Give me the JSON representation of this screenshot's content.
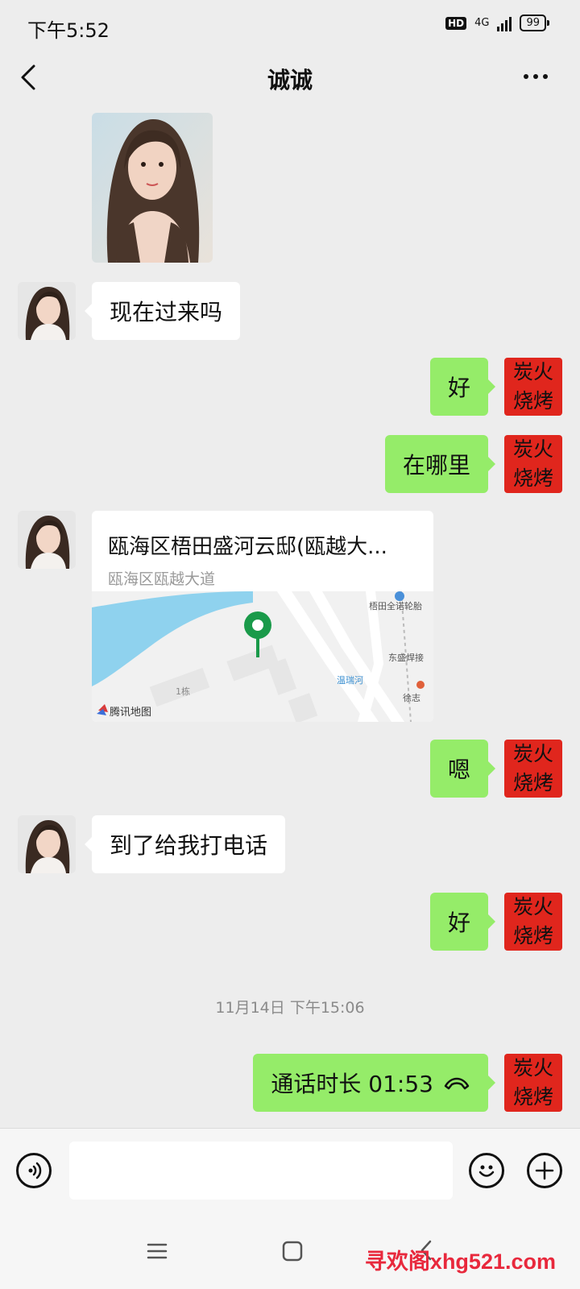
{
  "status_bar": {
    "time": "下午5:52",
    "hd_badge": "HD",
    "network": "4G",
    "battery": "99"
  },
  "header": {
    "title": "诚诚"
  },
  "messages": [
    {
      "type": "image",
      "from": "contact"
    },
    {
      "type": "text",
      "from": "contact",
      "text": "现在过来吗"
    },
    {
      "type": "text",
      "from": "me",
      "text": "好"
    },
    {
      "type": "text",
      "from": "me",
      "text": "在哪里"
    },
    {
      "type": "location",
      "from": "contact",
      "title": "瓯海区梧田盛河云邸(瓯越大...",
      "subtitle": "瓯海区瓯越大道",
      "map_labels": {
        "poi1": "梧田全诺轮胎",
        "poi2": "东盛焊接",
        "river": "温瑞河",
        "building": "1栋",
        "poi3": "徐志",
        "provider": "腾讯地图"
      }
    },
    {
      "type": "text",
      "from": "me",
      "text": "嗯"
    },
    {
      "type": "text",
      "from": "contact",
      "text": "到了给我打电话"
    },
    {
      "type": "text",
      "from": "me",
      "text": "好"
    },
    {
      "type": "timestamp",
      "text": "11月14日 下午15:06"
    },
    {
      "type": "call",
      "from": "me",
      "text": "通话时长 01:53"
    }
  ],
  "my_avatar": {
    "line1": "炭火",
    "line2": "烧烤",
    "bg": "#e0261d"
  },
  "input_bar": {
    "placeholder": ""
  },
  "watermark": "寻欢阁xhg521.com",
  "colors": {
    "background": "#ededed",
    "bubble_out": "#95ec69",
    "bubble_in": "#ffffff",
    "map_pin": "#1a9a4a"
  }
}
